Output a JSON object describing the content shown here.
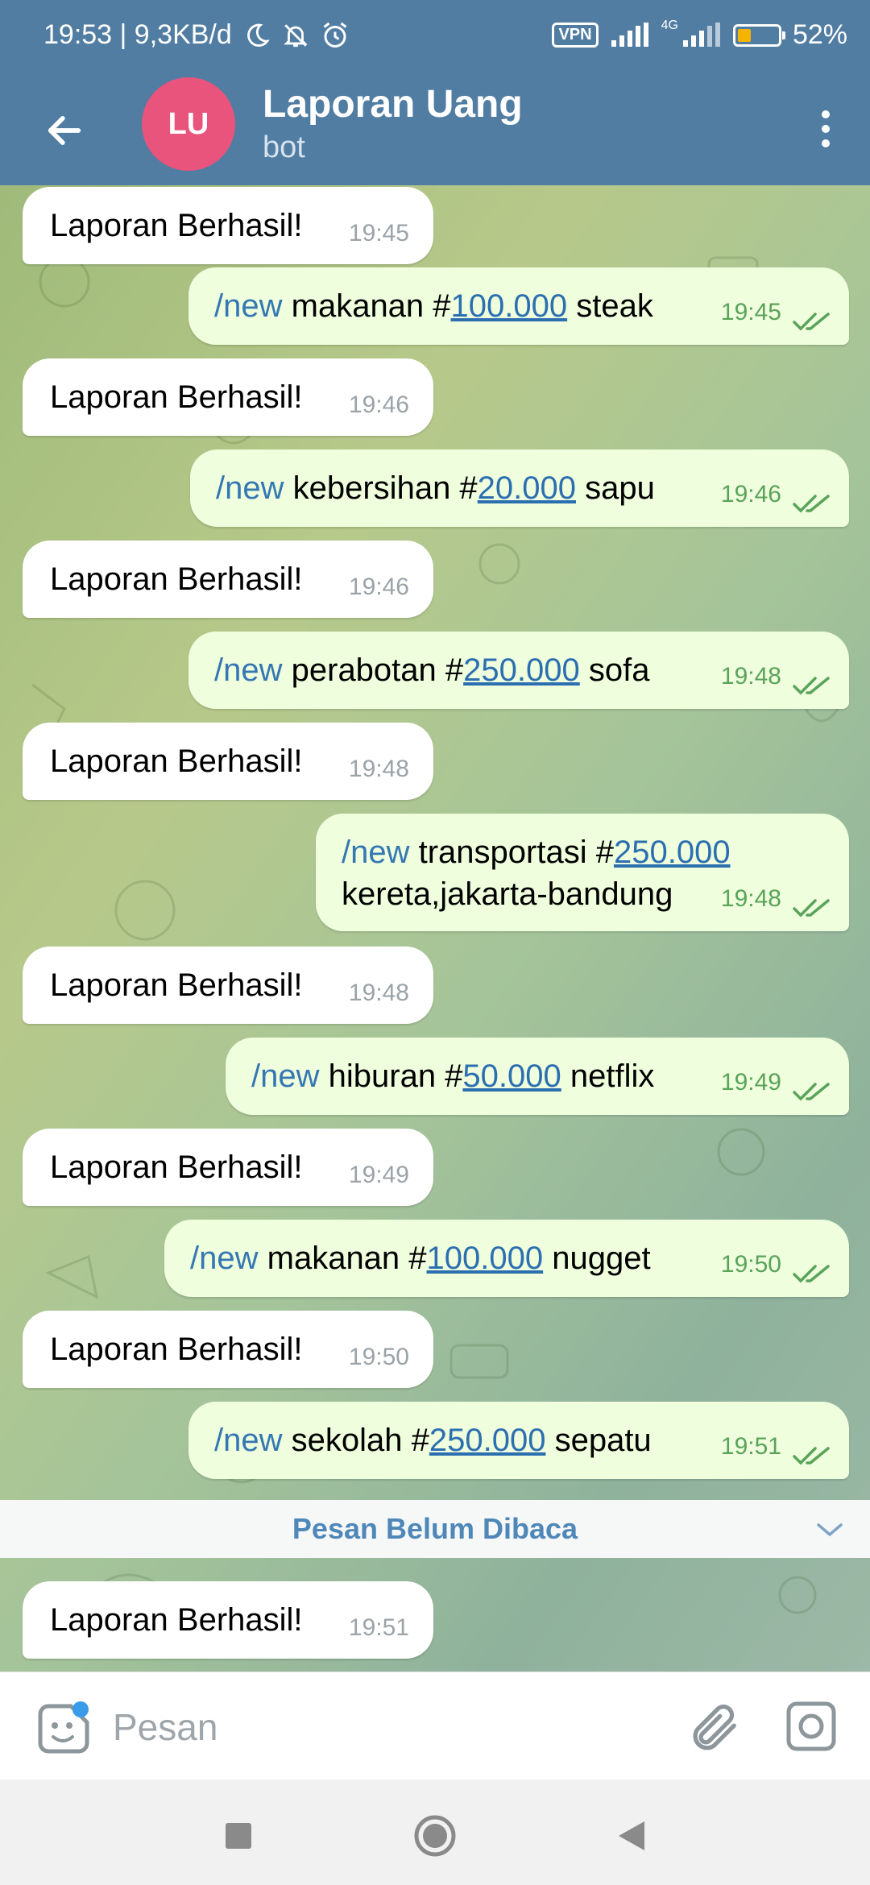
{
  "status_bar": {
    "time_speed": "19:53 | 9,3KB/d",
    "vpn_label": "VPN",
    "network_label": "4G",
    "battery_percent": "52%",
    "battery_level": 0.52
  },
  "header": {
    "avatar_initials": "LU",
    "avatar_color": "#e9547c",
    "title": "Laporan Uang",
    "subtitle": "bot"
  },
  "messages": [
    {
      "dir": "in",
      "text": "Laporan Berhasil!",
      "time": "19:45"
    },
    {
      "dir": "out",
      "cmd": "/new",
      "pre": "makanan #",
      "amount": "100.000",
      "post": "steak",
      "time": "19:45"
    },
    {
      "dir": "in",
      "text": "Laporan Berhasil!",
      "time": "19:46"
    },
    {
      "dir": "out",
      "cmd": "/new",
      "pre": "kebersihan #",
      "amount": "20.000",
      "post": "sapu",
      "time": "19:46"
    },
    {
      "dir": "in",
      "text": "Laporan Berhasil!",
      "time": "19:46"
    },
    {
      "dir": "out",
      "cmd": "/new",
      "pre": "perabotan #",
      "amount": "250.000",
      "post": "sofa",
      "time": "19:48"
    },
    {
      "dir": "in",
      "text": "Laporan Berhasil!",
      "time": "19:48"
    },
    {
      "dir": "out",
      "cmd": "/new",
      "pre": "transportasi #",
      "amount": "250.000",
      "post": "kereta,jakarta-bandung",
      "time": "19:48"
    },
    {
      "dir": "in",
      "text": "Laporan Berhasil!",
      "time": "19:48"
    },
    {
      "dir": "out",
      "cmd": "/new",
      "pre": "hiburan #",
      "amount": "50.000",
      "post": "netflix",
      "time": "19:49"
    },
    {
      "dir": "in",
      "text": "Laporan Berhasil!",
      "time": "19:49"
    },
    {
      "dir": "out",
      "cmd": "/new",
      "pre": "makanan #",
      "amount": "100.000",
      "post": "nugget",
      "time": "19:50"
    },
    {
      "dir": "in",
      "text": "Laporan Berhasil!",
      "time": "19:50"
    },
    {
      "dir": "out",
      "cmd": "/new",
      "pre": "sekolah #",
      "amount": "250.000",
      "post": "sepatu",
      "time": "19:51"
    },
    {
      "dir": "in",
      "text": "Laporan Berhasil!",
      "time": "19:51"
    }
  ],
  "unread_label": "Pesan Belum Dibaca",
  "input": {
    "placeholder": "Pesan",
    "value": ""
  },
  "icons": {
    "back": "arrow-left-icon",
    "menu": "more-vertical-icon",
    "emoji": "sticker-icon",
    "attach": "paperclip-icon",
    "camera": "camera-icon"
  },
  "colors": {
    "header": "#517da2",
    "outgoing_bubble": "#effedd",
    "incoming_bubble": "#ffffff",
    "link": "#3577b3",
    "check": "#5aa35a"
  }
}
